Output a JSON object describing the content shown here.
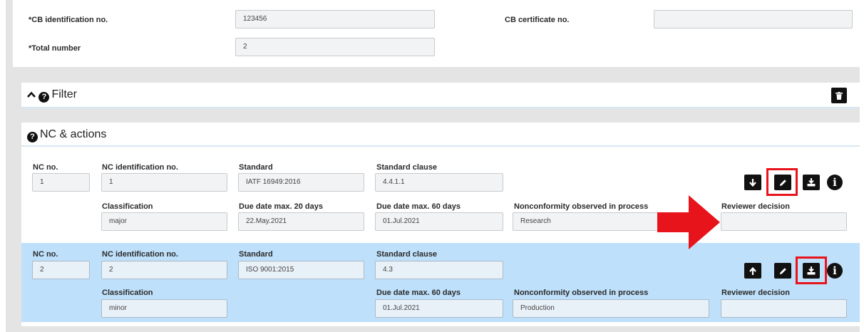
{
  "header": {
    "cb_id_label": "*CB identification no.",
    "cb_id_value": "123456",
    "cb_cert_label": "CB certificate no.",
    "cb_cert_value": "",
    "total_label": "*Total number",
    "total_value": "2"
  },
  "filter": {
    "title": "Filter"
  },
  "nc": {
    "title": "NC & actions",
    "rows": [
      {
        "nc_no_label": "NC no.",
        "nc_no": "1",
        "nc_ident_label": "NC identification no.",
        "nc_ident": "1",
        "standard_label": "Standard",
        "standard": "IATF 16949:2016",
        "clause_label": "Standard clause",
        "clause": "4.4.1.1",
        "classification_label": "Classification",
        "classification": "major",
        "due20_label": "Due date max. 20 days",
        "due20": "22.May.2021",
        "due60_label": "Due date max. 60 days",
        "due60": "01.Jul.2021",
        "process_label": "Nonconformity observed in process",
        "process": "Research",
        "reviewer_label": "Reviewer decision",
        "reviewer": ""
      },
      {
        "nc_no_label": "NC no.",
        "nc_no": "2",
        "nc_ident_label": "NC identification no.",
        "nc_ident": "2",
        "standard_label": "Standard",
        "standard": "ISO 9001:2015",
        "clause_label": "Standard clause",
        "clause": "4.3",
        "classification_label": "Classification",
        "classification": "minor",
        "due60_label": "Due date max. 60 days",
        "due60": "01.Jul.2021",
        "process_label": "Nonconformity observed in process",
        "process": "Production",
        "reviewer_label": "Reviewer decision",
        "reviewer": ""
      }
    ]
  },
  "icons": {
    "collapse": "chevron-up-icon",
    "help": "question-circle-icon",
    "trash": "trash-icon",
    "move_down": "arrow-down-icon",
    "move_up": "arrow-up-icon",
    "edit": "pencil-icon",
    "download": "download-icon",
    "info": "info-icon"
  },
  "colors": {
    "highlight": "#e8141c",
    "annotation_arrow": "#e8141c",
    "selected_row": "#bfe0fa",
    "backdrop": "#e4e4e4"
  }
}
